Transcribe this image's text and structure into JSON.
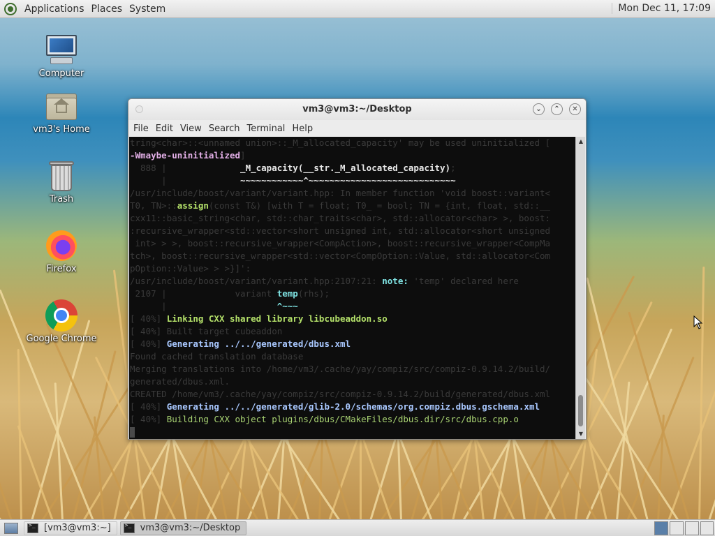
{
  "top_panel": {
    "menus": [
      "Applications",
      "Places",
      "System"
    ],
    "clock": "Mon Dec 11, 17:09"
  },
  "desktop_icons": {
    "computer": "Computer",
    "home": "vm3's Home",
    "trash": "Trash",
    "firefox": "Firefox",
    "chrome": "Google Chrome"
  },
  "window": {
    "title": "vm3@vm3:~/Desktop",
    "menu": [
      "File",
      "Edit",
      "View",
      "Search",
      "Terminal",
      "Help"
    ],
    "terminal_lines": [
      [
        {
          "t": "tring<char>::<unnamed union>::_M_allocated_capacity' may be used uninitialized [",
          "c": "dim"
        }
      ],
      [
        {
          "t": "-Wmaybe-uninitialized",
          "c": "c-magenta bold"
        },
        {
          "t": "]",
          "c": "dim"
        }
      ],
      [
        {
          "t": "  888 |              ",
          "c": "dim"
        },
        {
          "t": "_M_capacity(__str._M_allocated_capacity)",
          "c": "c-white bold"
        },
        {
          "t": ";",
          "c": "dim"
        }
      ],
      [
        {
          "t": "      |              ",
          "c": "dim"
        },
        {
          "t": "~~~~~~~~~~~~^~~~~~~~~~~~~~~~~~~~~~~~~~~~~",
          "c": "c-white bold"
        }
      ],
      [
        {
          "t": "/usr/include/boost/variant/variant.hpp:",
          "c": "dim"
        },
        {
          "t": " In member function 'void boost::variant<",
          "c": "dim"
        }
      ],
      [
        {
          "t": "T0, TN>::",
          "c": "dim"
        },
        {
          "t": "assign",
          "c": "c-green bold"
        },
        {
          "t": "(const T&) [with T = float; T0_ = bool; TN = {int, float, std::__",
          "c": "dim"
        }
      ],
      [
        {
          "t": "cxx11::basic_string<char, std::char_traits<char>, std::allocator<char> >, boost:",
          "c": "dim"
        }
      ],
      [
        {
          "t": ":recursive_wrapper<std::vector<short unsigned int, std::allocator<short unsigned",
          "c": "dim"
        }
      ],
      [
        {
          "t": " int> > >, boost::recursive_wrapper<CompAction>, boost::recursive_wrapper<CompMa",
          "c": "dim"
        }
      ],
      [
        {
          "t": "tch>, boost::recursive_wrapper<std::vector<CompOption::Value, std::allocator<Com",
          "c": "dim"
        }
      ],
      [
        {
          "t": "pOption::Value> > >}]':",
          "c": "dim"
        }
      ],
      [
        {
          "t": "/usr/include/boost/variant/variant.hpp:2107:21:",
          "c": "dim"
        },
        {
          "t": " note:",
          "c": "c-cyan bold"
        },
        {
          "t": " 'temp' declared here",
          "c": "dim"
        }
      ],
      [
        {
          "t": " 2107 |             variant ",
          "c": "dim"
        },
        {
          "t": "temp",
          "c": "c-cyan bold"
        },
        {
          "t": "(rhs);",
          "c": "dim"
        }
      ],
      [
        {
          "t": "      |                     ",
          "c": "dim"
        },
        {
          "t": "^~~~",
          "c": "c-cyan bold"
        }
      ],
      [
        {
          "t": "[ 40%] ",
          "c": "dim"
        },
        {
          "t": "Linking CXX shared library libcubeaddon.so",
          "c": "c-green bold"
        }
      ],
      [
        {
          "t": "[ 40%] Built target cubeaddon",
          "c": "dim"
        }
      ],
      [
        {
          "t": "[ 40%] ",
          "c": "dim"
        },
        {
          "t": "Generating ../../generated/dbus.xml",
          "c": "c-blue bold"
        }
      ],
      [
        {
          "t": "Found cached translation database",
          "c": "dim"
        }
      ],
      [
        {
          "t": "Merging translations into /home/vm3/.cache/yay/compiz/src/compiz-0.9.14.2/build/",
          "c": "dim"
        }
      ],
      [
        {
          "t": "generated/dbus.xml.",
          "c": "dim"
        }
      ],
      [
        {
          "t": "CREATED /home/vm3/.cache/yay/compiz/src/compiz-0.9.14.2/build/generated/dbus.xml",
          "c": "dim"
        }
      ],
      [
        {
          "t": "[ 40%] ",
          "c": "dim"
        },
        {
          "t": "Generating ../../generated/glib-2.0/schemas/org.compiz.dbus.gschema.xml",
          "c": "c-blue bold"
        }
      ],
      [
        {
          "t": "[ 40%] ",
          "c": "dim"
        },
        {
          "t": "Building CXX object plugins/dbus/CMakeFiles/dbus.dir/src/dbus.cpp.o",
          "c": "c-greenish"
        }
      ]
    ]
  },
  "bottom_panel": {
    "tasks": [
      "[vm3@vm3:~]",
      "vm3@vm3:~/Desktop"
    ]
  },
  "colors": {
    "terminal_bg": "#0d0d0d",
    "panel_bg": "#e4e4e4"
  }
}
